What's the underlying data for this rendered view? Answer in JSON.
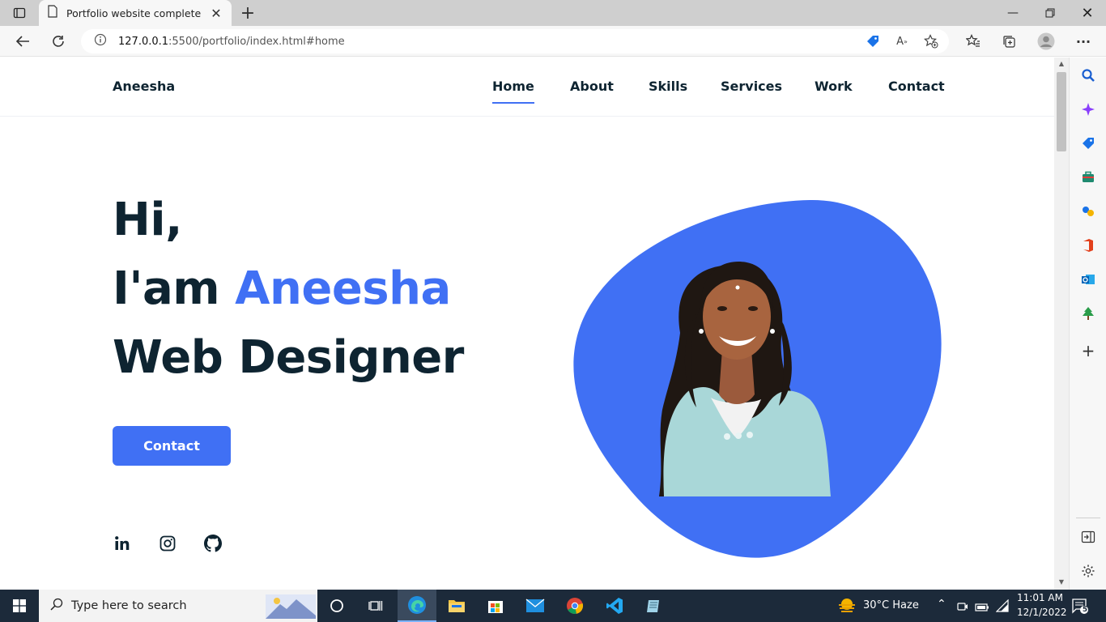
{
  "browser": {
    "tab_title": "Portfolio website complete",
    "url_host": "127.0.0.1",
    "url_path": ":5500/portfolio/index.html#home"
  },
  "site": {
    "logo": "Aneesha",
    "nav": [
      "Home",
      "About",
      "Skills",
      "Services",
      "Work",
      "Contact"
    ],
    "active_nav": "Home",
    "hero": {
      "line1": "Hi,",
      "line2_prefix": "I'am ",
      "line2_name": "Aneesha",
      "line3": "Web Designer"
    },
    "cta_label": "Contact",
    "social": [
      "linkedin-icon",
      "instagram-icon",
      "github-icon"
    ],
    "colors": {
      "accent": "#4070f4",
      "text": "#0e2431"
    }
  },
  "taskbar": {
    "search_placeholder": "Type here to search",
    "weather": "30°C  Haze",
    "time": "11:01 AM",
    "date": "12/1/2022",
    "notifications": "5"
  }
}
